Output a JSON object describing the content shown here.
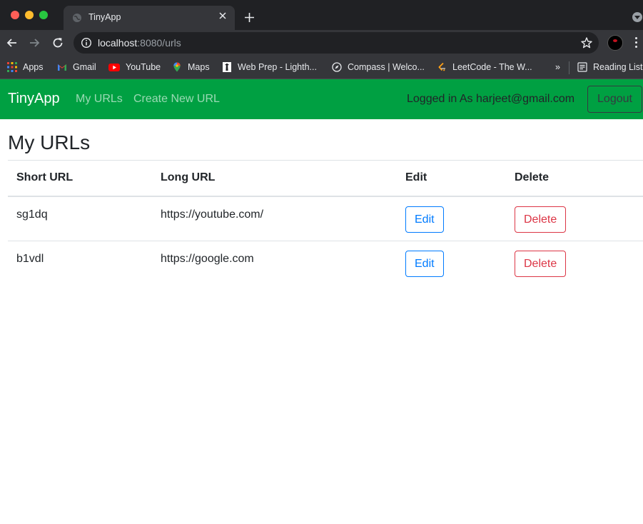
{
  "browser": {
    "tab_title": "TinyApp",
    "url_host": "localhost",
    "url_rest": ":8080/urls",
    "bookmarks": [
      {
        "label": "Apps",
        "icon": "apps-grid-icon"
      },
      {
        "label": "Gmail",
        "icon": "gmail-icon"
      },
      {
        "label": "YouTube",
        "icon": "youtube-icon"
      },
      {
        "label": "Maps",
        "icon": "maps-icon"
      },
      {
        "label": "Web Prep - Lighth...",
        "icon": "lighthouse-icon"
      },
      {
        "label": "Compass | Welco...",
        "icon": "compass-icon"
      },
      {
        "label": "LeetCode - The W...",
        "icon": "leetcode-icon"
      }
    ],
    "overflow_label": "»",
    "reading_list_label": "Reading List"
  },
  "navbar": {
    "brand": "TinyApp",
    "links": [
      "My URLs",
      "Create New URL"
    ],
    "user_text": "Logged in As harjeet@gmail.com",
    "logout_label": "Logout",
    "bg_color": "#00a042"
  },
  "main": {
    "title": "My URLs",
    "columns": [
      "Short URL",
      "Long URL",
      "Edit",
      "Delete"
    ],
    "rows": [
      {
        "short": "sg1dq",
        "long": "https://youtube.com/",
        "edit": "Edit",
        "delete": "Delete"
      },
      {
        "short": "b1vdl",
        "long": "https://google.com",
        "edit": "Edit",
        "delete": "Delete"
      }
    ]
  }
}
